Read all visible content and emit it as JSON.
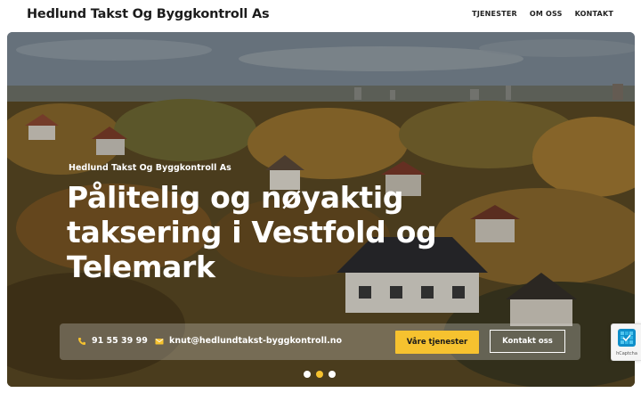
{
  "header": {
    "brand": "Hedlund Takst Og Byggkontroll As",
    "nav": [
      {
        "label": "TJENESTER"
      },
      {
        "label": "OM OSS"
      },
      {
        "label": "KONTAKT"
      }
    ]
  },
  "hero": {
    "eyebrow": "Hedlund Takst Og Byggkontroll As",
    "headline": "Pålitelig og nøyaktig taksering i Vestfold og Telemark",
    "phone": "91 55 39 99",
    "email": "knut@hedlundtakst-byggkontroll.no",
    "primary_button": "Våre tjenester",
    "secondary_button": "Kontakt oss",
    "slider": {
      "count": 3,
      "active_index": 1
    }
  },
  "captcha": {
    "label": "hCaptcha"
  },
  "colors": {
    "accent": "#f6c22f",
    "text_dark": "#1c1c1c",
    "white": "#ffffff"
  },
  "icons": {
    "phone": "phone-icon",
    "email": "envelope-icon",
    "captcha": "hcaptcha-logo-icon"
  }
}
